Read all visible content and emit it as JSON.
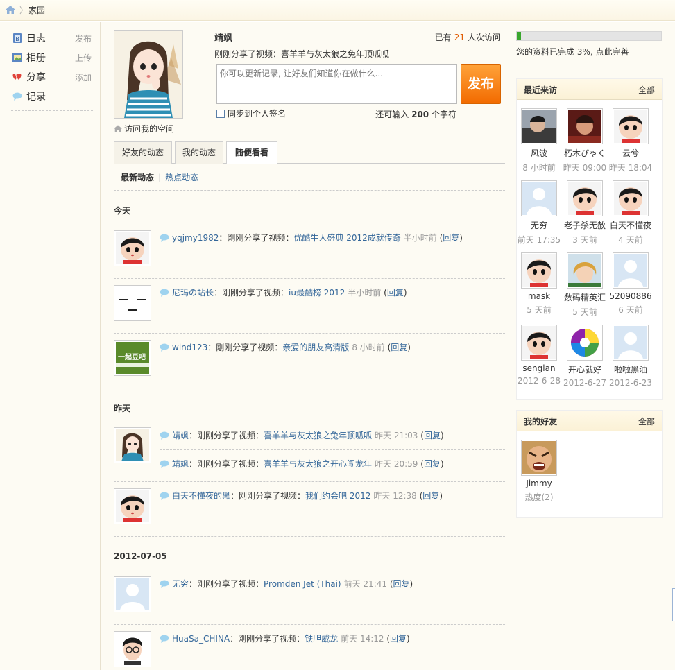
{
  "breadcrumb": {
    "current": "家园"
  },
  "nav": {
    "items": [
      {
        "label": "日志",
        "action": "发布",
        "icon": "blog-icon"
      },
      {
        "label": "相册",
        "action": "上传",
        "icon": "album-icon"
      },
      {
        "label": "分享",
        "action": "添加",
        "icon": "share-icon"
      },
      {
        "label": "记录",
        "action": "",
        "icon": "record-icon"
      }
    ]
  },
  "profile": {
    "name": "靖飒",
    "visits_prefix": "已有",
    "visits_count": "21",
    "visits_suffix": "人次访问",
    "latest_share": "刚刚分享了视频：喜羊羊与灰太狼之兔年顶呱呱",
    "visit_space": "访问我的空间"
  },
  "status": {
    "placeholder": "你可以更新记录, 让好友们知道你在做什么...",
    "publish_label": "发布",
    "sync_label": "同步到个人签名",
    "remain_prefix": "还可输入",
    "remain_count": "200",
    "remain_suffix": "个字符"
  },
  "tabs": [
    "好友的动态",
    "我的动态",
    "随便看看"
  ],
  "subtabs": {
    "current": "最新动态",
    "other": "热点动态"
  },
  "feed": {
    "action_text": "：刚刚分享了视频：",
    "reply_label": "回复",
    "days": [
      {
        "label": "今天",
        "entries": [
          {
            "user": "yqjmy1982",
            "title": "优酷牛人盛典 2012成就传奇",
            "time": "半小时前"
          },
          {
            "user": "尼玛の站长",
            "title": "iu最酷榜 2012",
            "time": "半小时前"
          },
          {
            "user": "wind123",
            "title": "亲爱的朋友高清版",
            "time": "8 小时前"
          }
        ]
      },
      {
        "label": "昨天",
        "entries": [
          {
            "user": "靖飒",
            "title": "喜羊羊与灰太狼之兔年顶呱呱",
            "time": "昨天 21:03"
          },
          {
            "user": "靖飒",
            "title": "喜羊羊与灰太狼之开心闯龙年",
            "time": "昨天 20:59"
          },
          {
            "user": "白天不懂夜的黑",
            "title": "我们约会吧 2012",
            "time": "昨天 12:38"
          }
        ]
      },
      {
        "label": "2012-07-05",
        "entries": [
          {
            "user": "无穷",
            "title": "Promden Jet (Thai)",
            "time": "前天 21:41"
          },
          {
            "user": "HuaSa_CHINA",
            "title": "铁胆威龙",
            "time": "前天 14:12"
          }
        ]
      }
    ],
    "avatar_badge_text": "一起豆吧"
  },
  "progress": {
    "percent": 3,
    "text": "您的资料已完成 3%, 点此完善"
  },
  "recent_visitors": {
    "title": "最近来访",
    "all_label": "全部",
    "items": [
      {
        "name": "风波",
        "time": "8 小时前"
      },
      {
        "name": "朽木びゃく",
        "time": "昨天 09:00"
      },
      {
        "name": "云兮",
        "time": "昨天 18:04"
      },
      {
        "name": "无穷",
        "time": "前天 17:35"
      },
      {
        "name": "老子杀无赦",
        "time": "3 天前"
      },
      {
        "name": "白天不懂夜",
        "time": "4 天前"
      },
      {
        "name": "mask",
        "time": "5 天前"
      },
      {
        "name": "数码精英汇",
        "time": "5 天前"
      },
      {
        "name": "52090886",
        "time": "6 天前"
      },
      {
        "name": "senglan",
        "time": "2012-6-28"
      },
      {
        "name": "开心就好",
        "time": "2012-6-27"
      },
      {
        "name": "啦啦黑油",
        "time": "2012-6-23"
      }
    ]
  },
  "friends": {
    "title": "我的好友",
    "all_label": "全部",
    "items": [
      {
        "name": "Jimmy",
        "heat": "热度(2)"
      }
    ]
  },
  "colors": {
    "link": "#336699",
    "accent": "#f26b00",
    "progress": "#3aa62d",
    "visit_count": "#e05a00"
  }
}
